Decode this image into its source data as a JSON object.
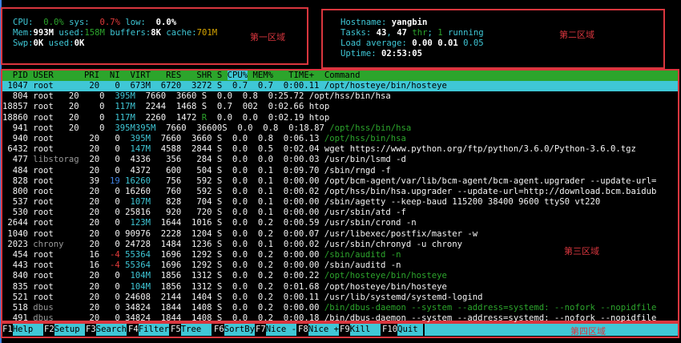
{
  "stats_left": {
    "line1": [
      [
        "CPU:  ",
        "cyan"
      ],
      [
        "0.0%",
        "green"
      ],
      [
        " sys:  ",
        "cyan"
      ],
      [
        "0.7%",
        "red"
      ],
      [
        " low:  ",
        "cyan"
      ],
      [
        "0.0%",
        "bold"
      ]
    ],
    "line2": [
      [
        "Mem:",
        "cyan"
      ],
      [
        "993M",
        "bold"
      ],
      [
        " used:",
        "cyan"
      ],
      [
        "158M",
        "green"
      ],
      [
        " buffers:",
        "cyan"
      ],
      [
        "8K",
        "bold"
      ],
      [
        " cache:",
        "cyan"
      ],
      [
        "701M",
        "yellow"
      ]
    ],
    "line3": [
      [
        "Swp:",
        "cyan"
      ],
      [
        "0K",
        "bold"
      ],
      [
        " used:",
        "cyan"
      ],
      [
        "0K",
        "bold"
      ]
    ]
  },
  "stats_right": {
    "line1": [
      [
        "Hostname: ",
        "cyan"
      ],
      [
        "yangbin",
        "bold"
      ]
    ],
    "line2": [
      [
        "Tasks: ",
        "cyan"
      ],
      [
        "43",
        "bold"
      ],
      [
        ", ",
        "cyan"
      ],
      [
        "47",
        "bold"
      ],
      [
        " thr",
        "green"
      ],
      [
        "; ",
        "cyan"
      ],
      [
        "1",
        "green"
      ],
      [
        " running",
        "cyan"
      ]
    ],
    "line3": [
      [
        "Load average: ",
        "cyan"
      ],
      [
        "0.00",
        "bold"
      ],
      [
        " ",
        "cyan"
      ],
      [
        "0.01",
        "bold"
      ],
      [
        " 0.05",
        "cyan"
      ]
    ],
    "line4": [
      [
        "Uptime: ",
        "cyan"
      ],
      [
        "02:53:05",
        "bold"
      ]
    ]
  },
  "zones": {
    "zone1": "第一区域",
    "zone2": "第二区域",
    "zone3": "第三区域",
    "zone4": "第四区域"
  },
  "process_header": [
    {
      "text": "  PID USER      PRI  NI  VIRT   RES   SHR S ",
      "cpu": false
    },
    {
      "text": "CPU%",
      "cpu": true
    },
    {
      "text": " MEM%   TIME+  Command",
      "cpu": false
    }
  ],
  "processes": [
    {
      "selected": true,
      "segs": [
        [
          " 1047 root       20   0  673M  6720  3272 S  0.7  0.7  0:00.11 /opt/hosteye/bin/hosteye",
          "white"
        ]
      ]
    },
    {
      "segs": [
        [
          "  804 root   20    0  ",
          "white"
        ],
        [
          "395M",
          "cyan"
        ],
        [
          "  7660  3660 S  0.0  0.8  0:25.72 /opt/hss/bin/hsa",
          "white"
        ]
      ]
    },
    {
      "segs": [
        [
          "18857 root   20    0  ",
          "white"
        ],
        [
          "117M",
          "cyan"
        ],
        [
          "  2244  1468 S  0.7  002  0:02.66 htop",
          "white"
        ]
      ]
    },
    {
      "segs": [
        [
          "18860 root   20    0  ",
          "white"
        ],
        [
          "117M",
          "cyan"
        ],
        [
          "  2260  1472 ",
          "white"
        ],
        [
          "R",
          "green"
        ],
        [
          "  0.0  0.0  0:02.19 htop",
          "white"
        ]
      ]
    },
    {
      "segs": [
        [
          "  941 root   20    0  ",
          "white"
        ],
        [
          "395M395M",
          "cyan"
        ],
        [
          "  7660  36600S  0.0  0.8  0:18.87 ",
          "white"
        ],
        [
          "/opt/hss/bin/hsa",
          "green"
        ]
      ]
    },
    {
      "segs": [
        [
          "  940 root       20   0  ",
          "white"
        ],
        [
          "395M",
          "cyan"
        ],
        [
          "  7660  3660 S  0.0  0.8  0:06.13 ",
          "white"
        ],
        [
          "/opt/hss/bin/hsa",
          "green"
        ]
      ]
    },
    {
      "segs": [
        [
          " 6432 root       20   0  ",
          "white"
        ],
        [
          "147M",
          "cyan"
        ],
        [
          "  4588  2844 S  0.0  0.5  0:02.04 wget https://www.python.org/ftp/python/3.6.0/Python-3.6.0.tgz",
          "white"
        ]
      ]
    },
    {
      "segs": [
        [
          "  477 ",
          "white"
        ],
        [
          "libstorag",
          "gray"
        ],
        [
          "  20   0  4336   356   284 S  0.0  0.0  0:00.03 /usr/bin/lsmd -d",
          "white"
        ]
      ]
    },
    {
      "segs": [
        [
          "  484 root       20   0  4372   600   504 S  0.0  0.1  0:09.70 /sbin/rngd -f",
          "white"
        ]
      ]
    },
    {
      "segs": [
        [
          "  828 root       39  ",
          "white"
        ],
        [
          "19",
          "blue"
        ],
        [
          " 16260",
          "cyan"
        ],
        [
          "   756   592 S  0.0  0.1  0:00.00 /opt/bcm-agent/var/lib/bcm-agent/bcm-agent.upgrader --update-url=",
          "white"
        ]
      ]
    },
    {
      "segs": [
        [
          "  800 root       20   0 16260   760   592 S  0.0  0.1  0:00.02 /opt/hss/bin/hsa.upgrader --update-url=http://download.bcm.baidub",
          "white"
        ]
      ]
    },
    {
      "segs": [
        [
          "  537 root       20   0  ",
          "white"
        ],
        [
          "107M",
          "cyan"
        ],
        [
          "   828   704 S  0.0  0.1  0:00.00 /sbin/agetty --keep-baud 115200 38400 9600 ttyS0 vt220",
          "white"
        ]
      ]
    },
    {
      "segs": [
        [
          "  530 root       20   0 25816   920   720 S  0.0  0.1  0:00.00 /usr/sbin/atd -f",
          "white"
        ]
      ]
    },
    {
      "segs": [
        [
          " 2644 root       20   0  ",
          "white"
        ],
        [
          "123M",
          "cyan"
        ],
        [
          "  1644  1016 S  0.0  0.2  0:00.59 /usr/sbin/crond -n",
          "white"
        ]
      ]
    },
    {
      "segs": [
        [
          " 1040 root       20   0 90976  2228  1204 S  0.0  0.2  0:00.07 /usr/libexec/postfix/master -w",
          "white"
        ]
      ]
    },
    {
      "segs": [
        [
          " 2023 ",
          "white"
        ],
        [
          "chrony",
          "gray"
        ],
        [
          "     20   0 24728  1484  1236 S  0.0  0.1  0:00.02 /usr/sbin/chronyd -u chrony",
          "white"
        ]
      ]
    },
    {
      "segs": [
        [
          "  454 root       16  ",
          "white"
        ],
        [
          "-4",
          "red"
        ],
        [
          " 55364",
          "cyan"
        ],
        [
          "  1696  1292 S  0.0  0.2  0:00.00 ",
          "white"
        ],
        [
          "/sbin/auditd -n",
          "green"
        ]
      ]
    },
    {
      "segs": [
        [
          "  443 root       16  ",
          "white"
        ],
        [
          "-4",
          "red"
        ],
        [
          " 55364",
          "cyan"
        ],
        [
          "  1696  1292 S  0.0  0.2  0:00.00 /sbin/auditd -n",
          "white"
        ]
      ]
    },
    {
      "segs": [
        [
          "  840 root       20   0  ",
          "white"
        ],
        [
          "104M",
          "cyan"
        ],
        [
          "  1856  1312 S  0.0  0.2  0:00.22 ",
          "white"
        ],
        [
          "/opt/hosteye/bin/hosteye",
          "green"
        ]
      ]
    },
    {
      "segs": [
        [
          "  835 root       20   0  ",
          "white"
        ],
        [
          "104M",
          "cyan"
        ],
        [
          "  1856  1312 S  0.0  0.2  0:01.68 /opt/hosteye/bin/hosteye",
          "white"
        ]
      ]
    },
    {
      "segs": [
        [
          "  521 root       20   0 24608  2144  1404 S  0.0  0.2  0:00.11 /usr/lib/systemd/systemd-logind",
          "white"
        ]
      ]
    },
    {
      "segs": [
        [
          "  518 ",
          "white"
        ],
        [
          "dbus",
          "gray"
        ],
        [
          "       20   0 34824  1844  1408 S  0.0  0.2  0:00.00 ",
          "white"
        ],
        [
          "/bin/dbus-daemon --system --address=systemd: --nofork --nopidfile",
          "green"
        ]
      ]
    },
    {
      "segs": [
        [
          "  491 ",
          "white"
        ],
        [
          "dbus",
          "gray"
        ],
        [
          "       20   0 34824  1844  1408 S  0.0  0.2  0:00.18 /bin/dbus-daemon --system --address=systemd: --nofork --nopidfile",
          "white"
        ]
      ]
    }
  ],
  "function_keys": [
    {
      "key": "F1",
      "label": "Help  "
    },
    {
      "key": "F2",
      "label": "Setup "
    },
    {
      "key": "F3",
      "label": "Search"
    },
    {
      "key": "F4",
      "label": "Filter"
    },
    {
      "key": "F5",
      "label": "Tree  "
    },
    {
      "key": "F6",
      "label": "SortBy"
    },
    {
      "key": "F7",
      "label": "Nice -"
    },
    {
      "key": "F8",
      "label": "Nice +"
    },
    {
      "key": "F9",
      "label": "Kill  "
    },
    {
      "key": "F10",
      "label": "Quit "
    }
  ]
}
